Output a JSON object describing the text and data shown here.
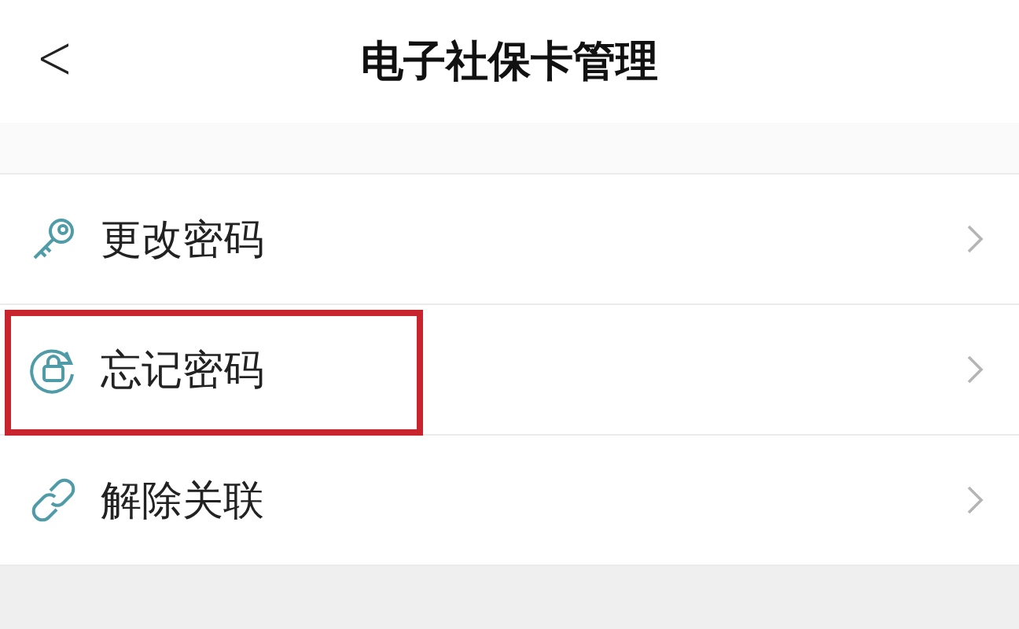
{
  "header": {
    "back": "<",
    "title": "电子社保卡管理"
  },
  "menu": [
    {
      "label": "更改密码",
      "highlighted": false
    },
    {
      "label": "忘记密码",
      "highlighted": true
    },
    {
      "label": "解除关联",
      "highlighted": false
    }
  ]
}
